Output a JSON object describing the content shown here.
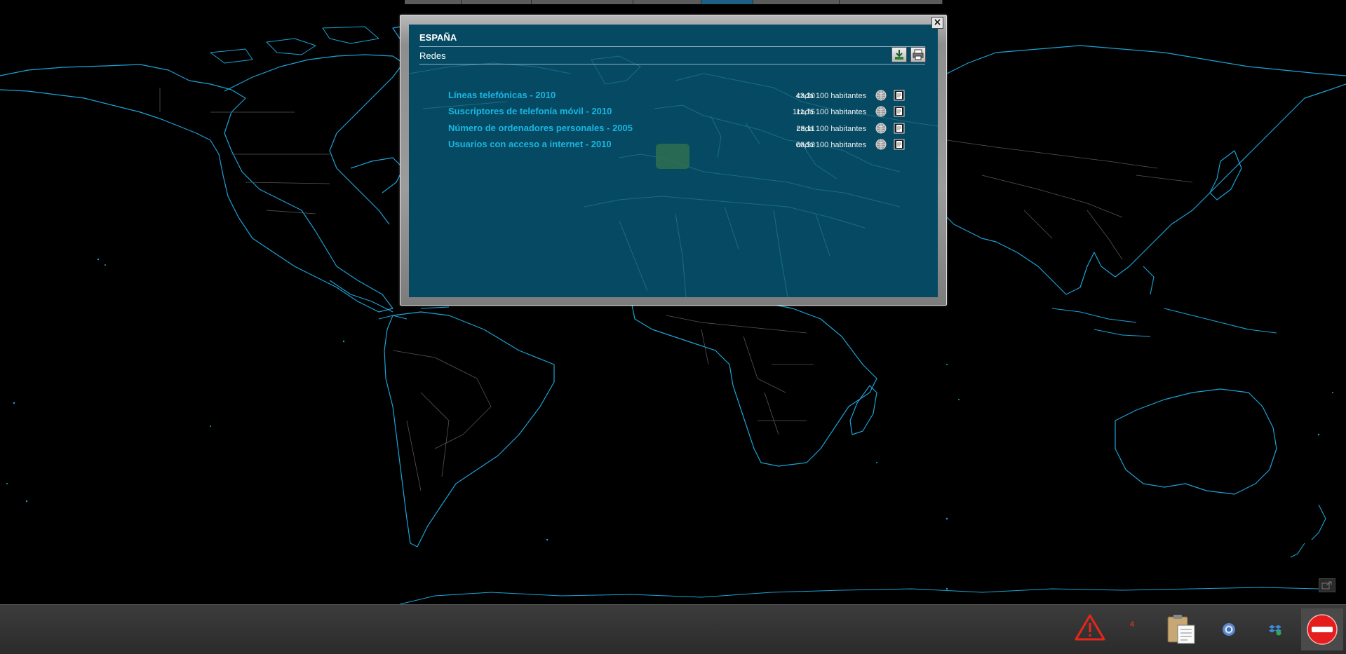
{
  "tabs": [
    {
      "active": false
    },
    {
      "active": false
    },
    {
      "active": false
    },
    {
      "active": false
    },
    {
      "active": true
    },
    {
      "active": false
    },
    {
      "active": false
    }
  ],
  "dialog": {
    "country": "ESPAÑA",
    "section": "Redes",
    "close_label": "×",
    "rows": [
      {
        "label": "Líneas telefónicas - 2010",
        "value": "43,20",
        "unit": "cada 100 habitantes"
      },
      {
        "label": "Suscriptores de telefonía móvil - 2010",
        "value": "111,75",
        "unit": "cada 100 habitantes"
      },
      {
        "label": "Número de ordenadores personales - 2005",
        "value": "28,11",
        "unit": "cada 100 habitantes"
      },
      {
        "label": "Usuarios con acceso a internet - 2010",
        "value": "66,53",
        "unit": "cada 100 habitantes"
      }
    ]
  },
  "taskbar": {
    "warning_count": "4"
  },
  "colors": {
    "coastline": "#1ba3d6",
    "border": "#555555",
    "panel": "#054a62",
    "link": "#1ab6e3",
    "active_tab": "#1e5f84"
  }
}
